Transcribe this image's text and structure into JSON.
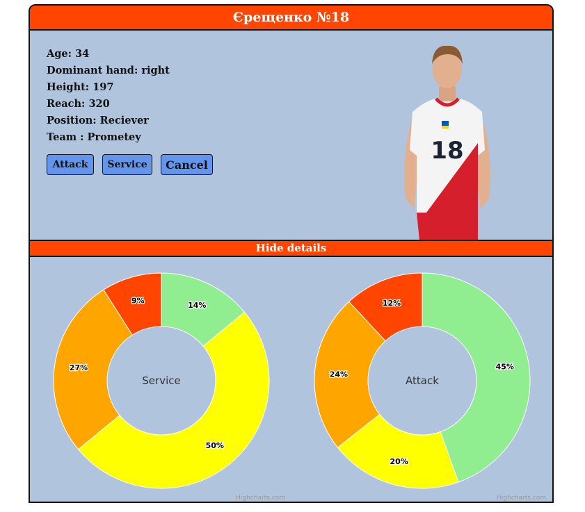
{
  "player": {
    "title": "Єрещенко №18",
    "info": [
      "Age: 34",
      "Dominant hand: right",
      "Height: 197",
      "Reach: 320",
      "Position: Reciever",
      "Team : Prometey"
    ],
    "jersey_number": "18"
  },
  "buttons": {
    "attack": "Attack",
    "service": "Service",
    "cancel": "Cancel"
  },
  "toggle_label": "Hide details",
  "chart_data": [
    {
      "type": "pie",
      "title": "Service",
      "categories": [
        "green",
        "yellow",
        "orange",
        "red"
      ],
      "values": [
        14,
        50,
        27,
        9
      ],
      "labels": [
        "14%",
        "50%",
        "27%",
        "9%"
      ],
      "colors": [
        "#90ee90",
        "#ffff00",
        "#ffa500",
        "#ff4500"
      ],
      "credit": "Highcharts.com"
    },
    {
      "type": "pie",
      "title": "Attack",
      "categories": [
        "green",
        "yellow",
        "orange",
        "red"
      ],
      "values": [
        45,
        20,
        24,
        12
      ],
      "labels": [
        "45%",
        "20%",
        "24%",
        "12%"
      ],
      "colors": [
        "#90ee90",
        "#ffff00",
        "#ffa500",
        "#ff4500"
      ],
      "credit": "Highcharts.com"
    }
  ]
}
